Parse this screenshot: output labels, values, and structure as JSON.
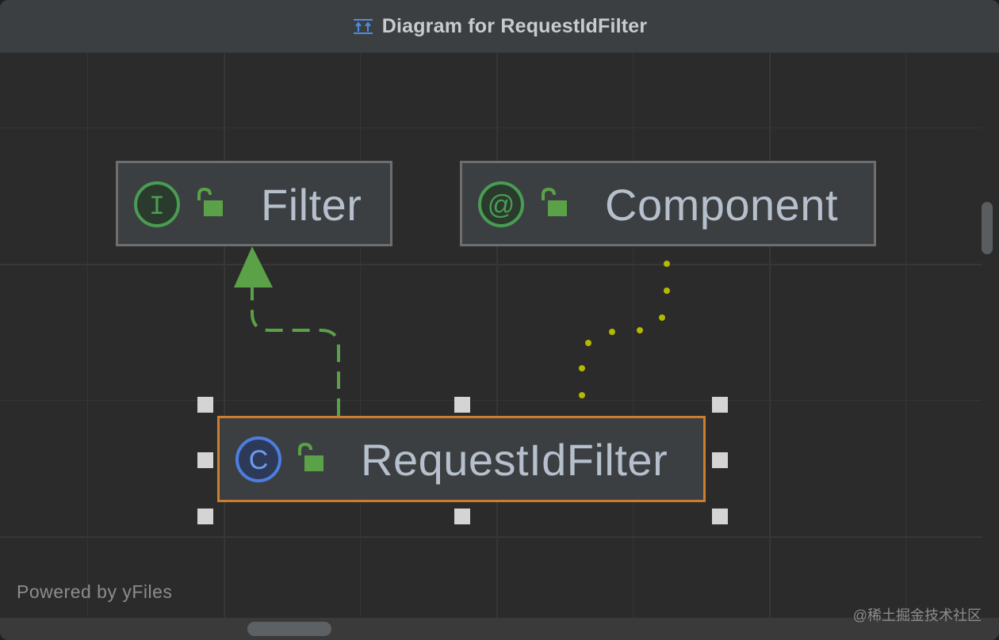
{
  "window": {
    "title": "Diagram for RequestIdFilter",
    "title_icon": "hierarchy-diagram-icon"
  },
  "nodes": {
    "filter": {
      "label": "Filter",
      "kind": "interface",
      "badge_letter": "I",
      "badge_color": "#499c54",
      "lock_icon": "unlocked-public-icon"
    },
    "component": {
      "label": "Component",
      "kind": "annotation",
      "badge_letter": "@",
      "badge_color": "#499c54",
      "lock_icon": "unlocked-public-icon"
    },
    "request_id_filter": {
      "label": "RequestIdFilter",
      "kind": "class",
      "badge_letter": "C",
      "badge_color": "#3d6bce",
      "lock_icon": "unlocked-public-icon",
      "selected": true
    }
  },
  "edges": [
    {
      "from": "RequestIdFilter",
      "to": "Filter",
      "type": "implements",
      "style": "dashed",
      "color": "#5aa147"
    },
    {
      "from": "RequestIdFilter",
      "to": "Component",
      "type": "annotated-by",
      "style": "dotted",
      "color": "#b5b800"
    }
  ],
  "footer": {
    "powered_by": "Powered by yFiles"
  },
  "watermark": "@稀土掘金技术社区",
  "colors": {
    "background": "#2b2b2b",
    "node_fill": "#3c3f41",
    "node_border": "#6e6e6e",
    "selection_border": "#cc7d2e",
    "label_text": "#b6c0cc"
  }
}
